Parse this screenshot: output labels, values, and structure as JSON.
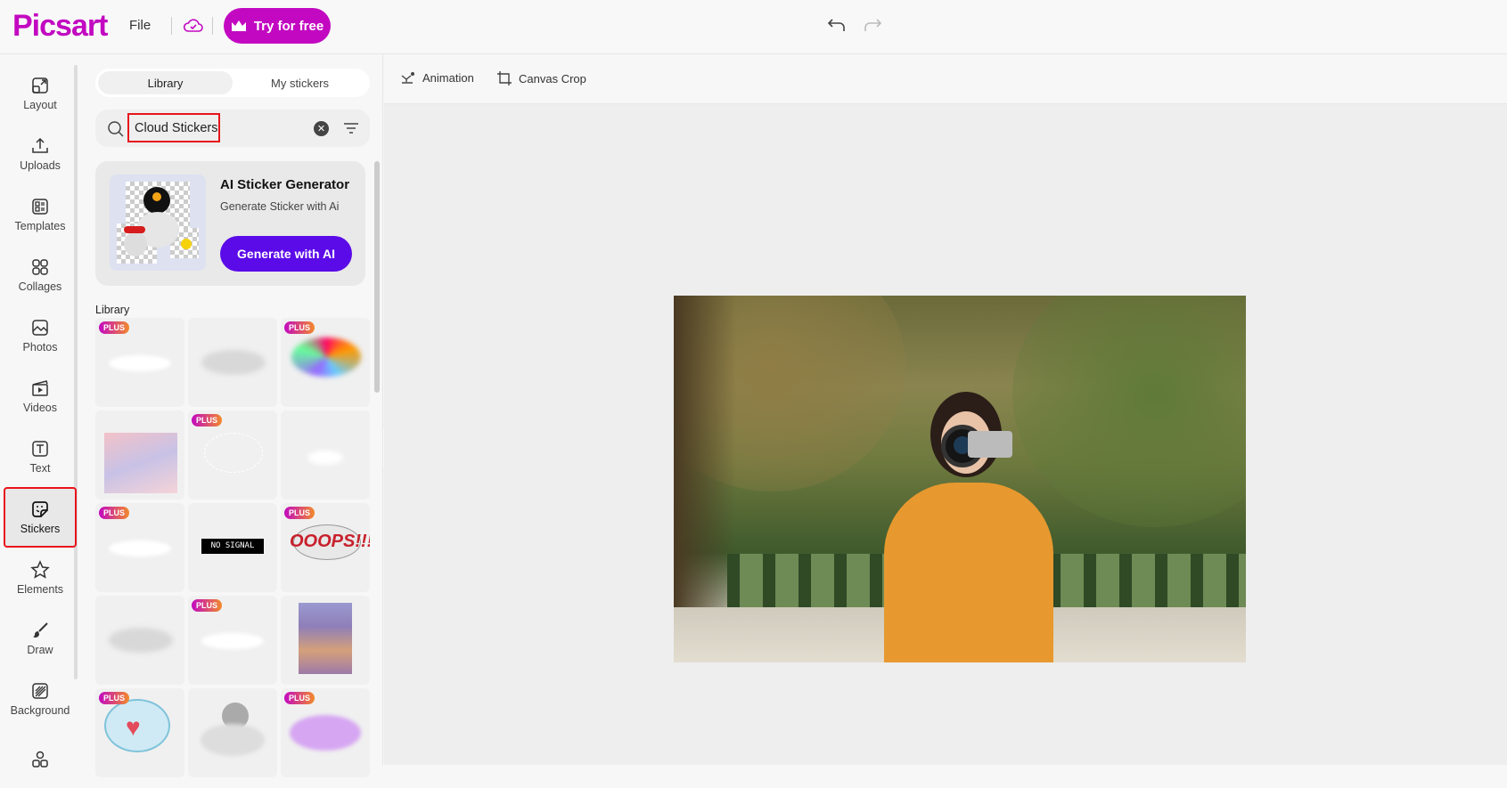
{
  "header": {
    "logo": "Picsart",
    "file_label": "File",
    "try_label": "Try for free"
  },
  "colors": {
    "brand": "#c209c1",
    "accent": "#5b0ae8",
    "highlight": "#e8141b"
  },
  "rail": {
    "items": [
      {
        "label": "Layout",
        "icon": "layout-icon"
      },
      {
        "label": "Uploads",
        "icon": "upload-icon"
      },
      {
        "label": "Templates",
        "icon": "templates-icon"
      },
      {
        "label": "Collages",
        "icon": "collages-icon"
      },
      {
        "label": "Photos",
        "icon": "photo-icon"
      },
      {
        "label": "Videos",
        "icon": "video-icon"
      },
      {
        "label": "Text",
        "icon": "text-icon"
      },
      {
        "label": "Stickers",
        "icon": "sticker-icon",
        "active": true
      },
      {
        "label": "Elements",
        "icon": "star-icon"
      },
      {
        "label": "Draw",
        "icon": "brush-icon"
      },
      {
        "label": "Background",
        "icon": "background-icon"
      }
    ]
  },
  "panel": {
    "tabs": [
      {
        "label": "Library",
        "active": true
      },
      {
        "label": "My stickers"
      }
    ],
    "search": {
      "value": "Cloud Stickers"
    },
    "ai_card": {
      "title": "AI Sticker Generator",
      "subtitle": "Generate Sticker with Ai",
      "button": "Generate with AI"
    },
    "library_label": "Library",
    "plus_badge": "PLUS",
    "stickers": [
      {
        "kind": "white-cloud",
        "plus": true
      },
      {
        "kind": "grey-cloud",
        "plus": false
      },
      {
        "kind": "colorful-cloud",
        "plus": true
      },
      {
        "kind": "pink-sky",
        "plus": false
      },
      {
        "kind": "outline-cloud",
        "plus": true
      },
      {
        "kind": "faint-cloud",
        "plus": false
      },
      {
        "kind": "white-cloud",
        "plus": true
      },
      {
        "kind": "no-signal",
        "plus": false,
        "text": "NO SIGNAL"
      },
      {
        "kind": "oops",
        "plus": true,
        "text": "OOOPS!!!"
      },
      {
        "kind": "grey-cloud",
        "plus": false
      },
      {
        "kind": "white-cloud",
        "plus": true
      },
      {
        "kind": "purple-sky",
        "plus": false
      },
      {
        "kind": "heart-cloud",
        "plus": true
      },
      {
        "kind": "moon-cloud",
        "plus": false
      },
      {
        "kind": "purple-cloud",
        "plus": true
      }
    ]
  },
  "toolbar": {
    "animation_label": "Animation",
    "crop_label": "Canvas Crop"
  }
}
